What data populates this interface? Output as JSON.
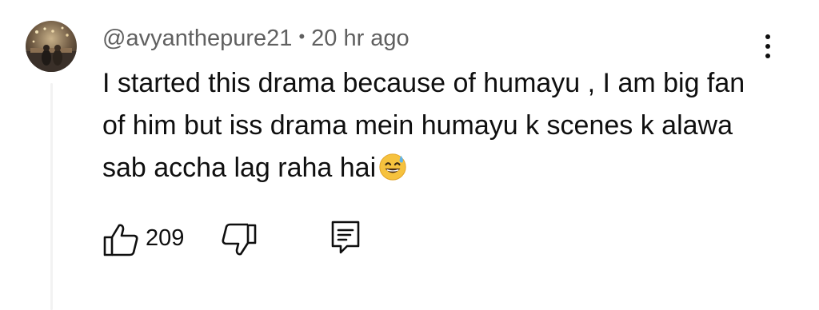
{
  "comment": {
    "author": "@avyanthepure21",
    "separator": "•",
    "time": "20 hr ago",
    "text": "I started this drama because of humayu , I am big fan of him but iss drama mein humayu k scenes k alawa sab accha lag raha hai",
    "emoji": "sweat-smile-emoji"
  },
  "actions": {
    "like_icon": "thumbs-up-icon",
    "like_count": "209",
    "dislike_icon": "thumbs-down-icon",
    "reply_icon": "reply-comment-icon",
    "more_icon": "more-vertical-icon"
  },
  "colors": {
    "text_primary": "#0f0f0f",
    "text_secondary": "#606060",
    "background": "#ffffff",
    "thread_line": "#f2f2f2",
    "emoji_fill": "#f6c23e"
  }
}
